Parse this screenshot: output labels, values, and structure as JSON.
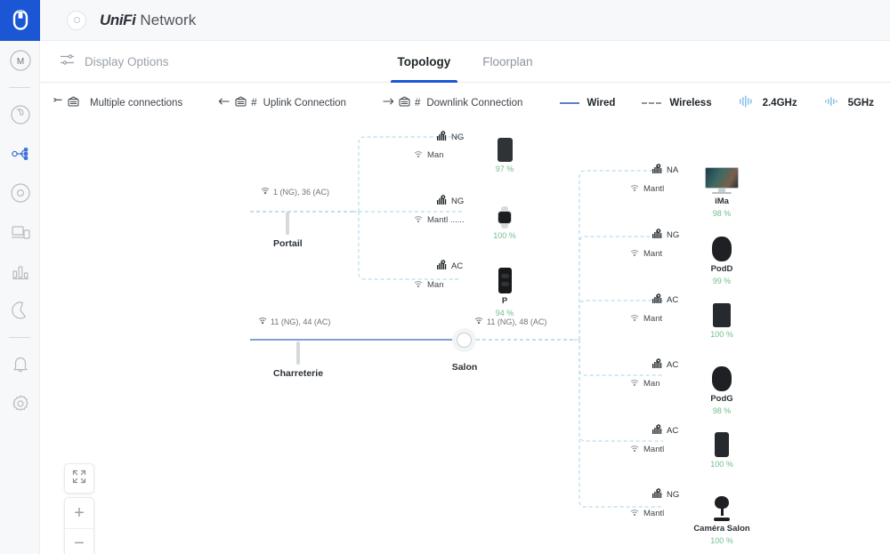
{
  "brand": {
    "product_bold": "UniFi",
    "product_rest": "Network"
  },
  "sidebar": {
    "avatar_initial": "M",
    "items": [
      {
        "name": "user-avatar",
        "label": "M"
      },
      {
        "name": "dashboard",
        "label": "Dashboard"
      },
      {
        "name": "topology",
        "label": "Topology"
      },
      {
        "name": "devices",
        "label": "Devices"
      },
      {
        "name": "clients",
        "label": "Clients"
      },
      {
        "name": "statistics",
        "label": "Statistics"
      },
      {
        "name": "insights",
        "label": "Insights"
      },
      {
        "name": "alerts",
        "label": "Alerts"
      },
      {
        "name": "settings",
        "label": "Settings"
      }
    ]
  },
  "toolbar": {
    "display_options": "Display Options",
    "tabs": [
      {
        "label": "Topology",
        "active": true
      },
      {
        "label": "Floorplan",
        "active": false
      }
    ]
  },
  "legend": {
    "multiple_connections": "Multiple connections",
    "uplink": "Uplink Connection",
    "downlink": "Downlink Connection",
    "hash": "#",
    "wired": "Wired",
    "wireless": "Wireless",
    "band_24": "2.4GHz",
    "band_5": "5GHz"
  },
  "topology": {
    "access_points": [
      {
        "name": "Portail",
        "channels": "1 (NG), 36 (AC)"
      },
      {
        "name": "Charreterie",
        "channels": "11 (NG), 44 (AC)"
      },
      {
        "name": "Salon",
        "channels": "11 (NG), 48 (AC)"
      }
    ],
    "clients": [
      {
        "id": "c1",
        "radio": "NG",
        "wifi": "Man",
        "name": "",
        "signal": "97 %",
        "device": "phone-orange"
      },
      {
        "id": "c2",
        "radio": "NG",
        "wifi": "Mantl ......",
        "name": "",
        "signal": "100 %",
        "device": "apple-watch"
      },
      {
        "id": "c3",
        "radio": "AC",
        "wifi": "Man",
        "name": "P",
        "signal": "94 %",
        "device": "phone-dark"
      },
      {
        "id": "c4",
        "radio": "NA",
        "wifi": "Mantl",
        "name": "iMa",
        "signal": "98 %",
        "device": "imac"
      },
      {
        "id": "c5",
        "radio": "NG",
        "wifi": "Mant",
        "name": "PodD",
        "signal": "99 %",
        "device": "homepod"
      },
      {
        "id": "c6",
        "radio": "AC",
        "wifi": "Mant",
        "name": "",
        "signal": "100 %",
        "device": "tablet"
      },
      {
        "id": "c7",
        "radio": "AC",
        "wifi": "Man",
        "name": "PodG",
        "signal": "98 %",
        "device": "homepod"
      },
      {
        "id": "c8",
        "radio": "AC",
        "wifi": "Mantl",
        "name": "",
        "signal": "100 %",
        "device": "phone-photo"
      },
      {
        "id": "c9",
        "radio": "NG",
        "wifi": "Mantl",
        "name": "Caméra Salon",
        "signal": "100 %",
        "device": "camera"
      }
    ]
  },
  "controls": {
    "fit": "Fit to screen",
    "zoom_in": "+",
    "zoom_out": "−"
  },
  "colors": {
    "brand_blue": "#1b57d4",
    "wired_line": "#5b7fc7",
    "wireless_line": "#b9dced",
    "signal_green": "#6fbf8e"
  }
}
